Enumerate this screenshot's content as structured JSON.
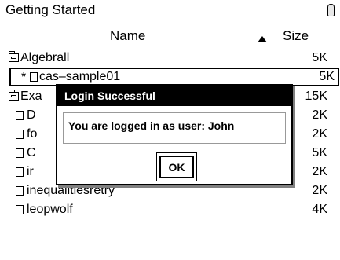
{
  "titlebar": {
    "title": "Getting Started"
  },
  "columns": {
    "name": "Name",
    "size": "Size"
  },
  "rows": [
    {
      "name": "Algebrall",
      "size": "5K",
      "type": "folder",
      "selected": false,
      "star": ""
    },
    {
      "name": "cas–sample01",
      "size": "5K",
      "type": "document",
      "selected": true,
      "star": "*"
    },
    {
      "name": "Exa",
      "size": "15K",
      "type": "folder",
      "selected": false,
      "star": ""
    },
    {
      "name": "D",
      "size": "2K",
      "type": "document",
      "selected": false,
      "star": ""
    },
    {
      "name": "fo",
      "size": "2K",
      "type": "document",
      "selected": false,
      "star": ""
    },
    {
      "name": "C",
      "size": "5K",
      "type": "document",
      "selected": false,
      "star": ""
    },
    {
      "name": "ir",
      "size": "2K",
      "type": "document",
      "selected": false,
      "star": ""
    },
    {
      "name": "inequalitiesretry",
      "size": "2K",
      "type": "document",
      "selected": false,
      "star": ""
    },
    {
      "name": "leopwolf",
      "size": "4K",
      "type": "document",
      "selected": false,
      "star": ""
    }
  ],
  "dialog": {
    "title": "Login Successful",
    "message": "You are logged in as user: John",
    "ok_label": "OK"
  },
  "icons": {
    "battery": "battery-icon",
    "sort": "sort-ascending-icon",
    "folder": "folder-icon",
    "document": "document-icon"
  }
}
